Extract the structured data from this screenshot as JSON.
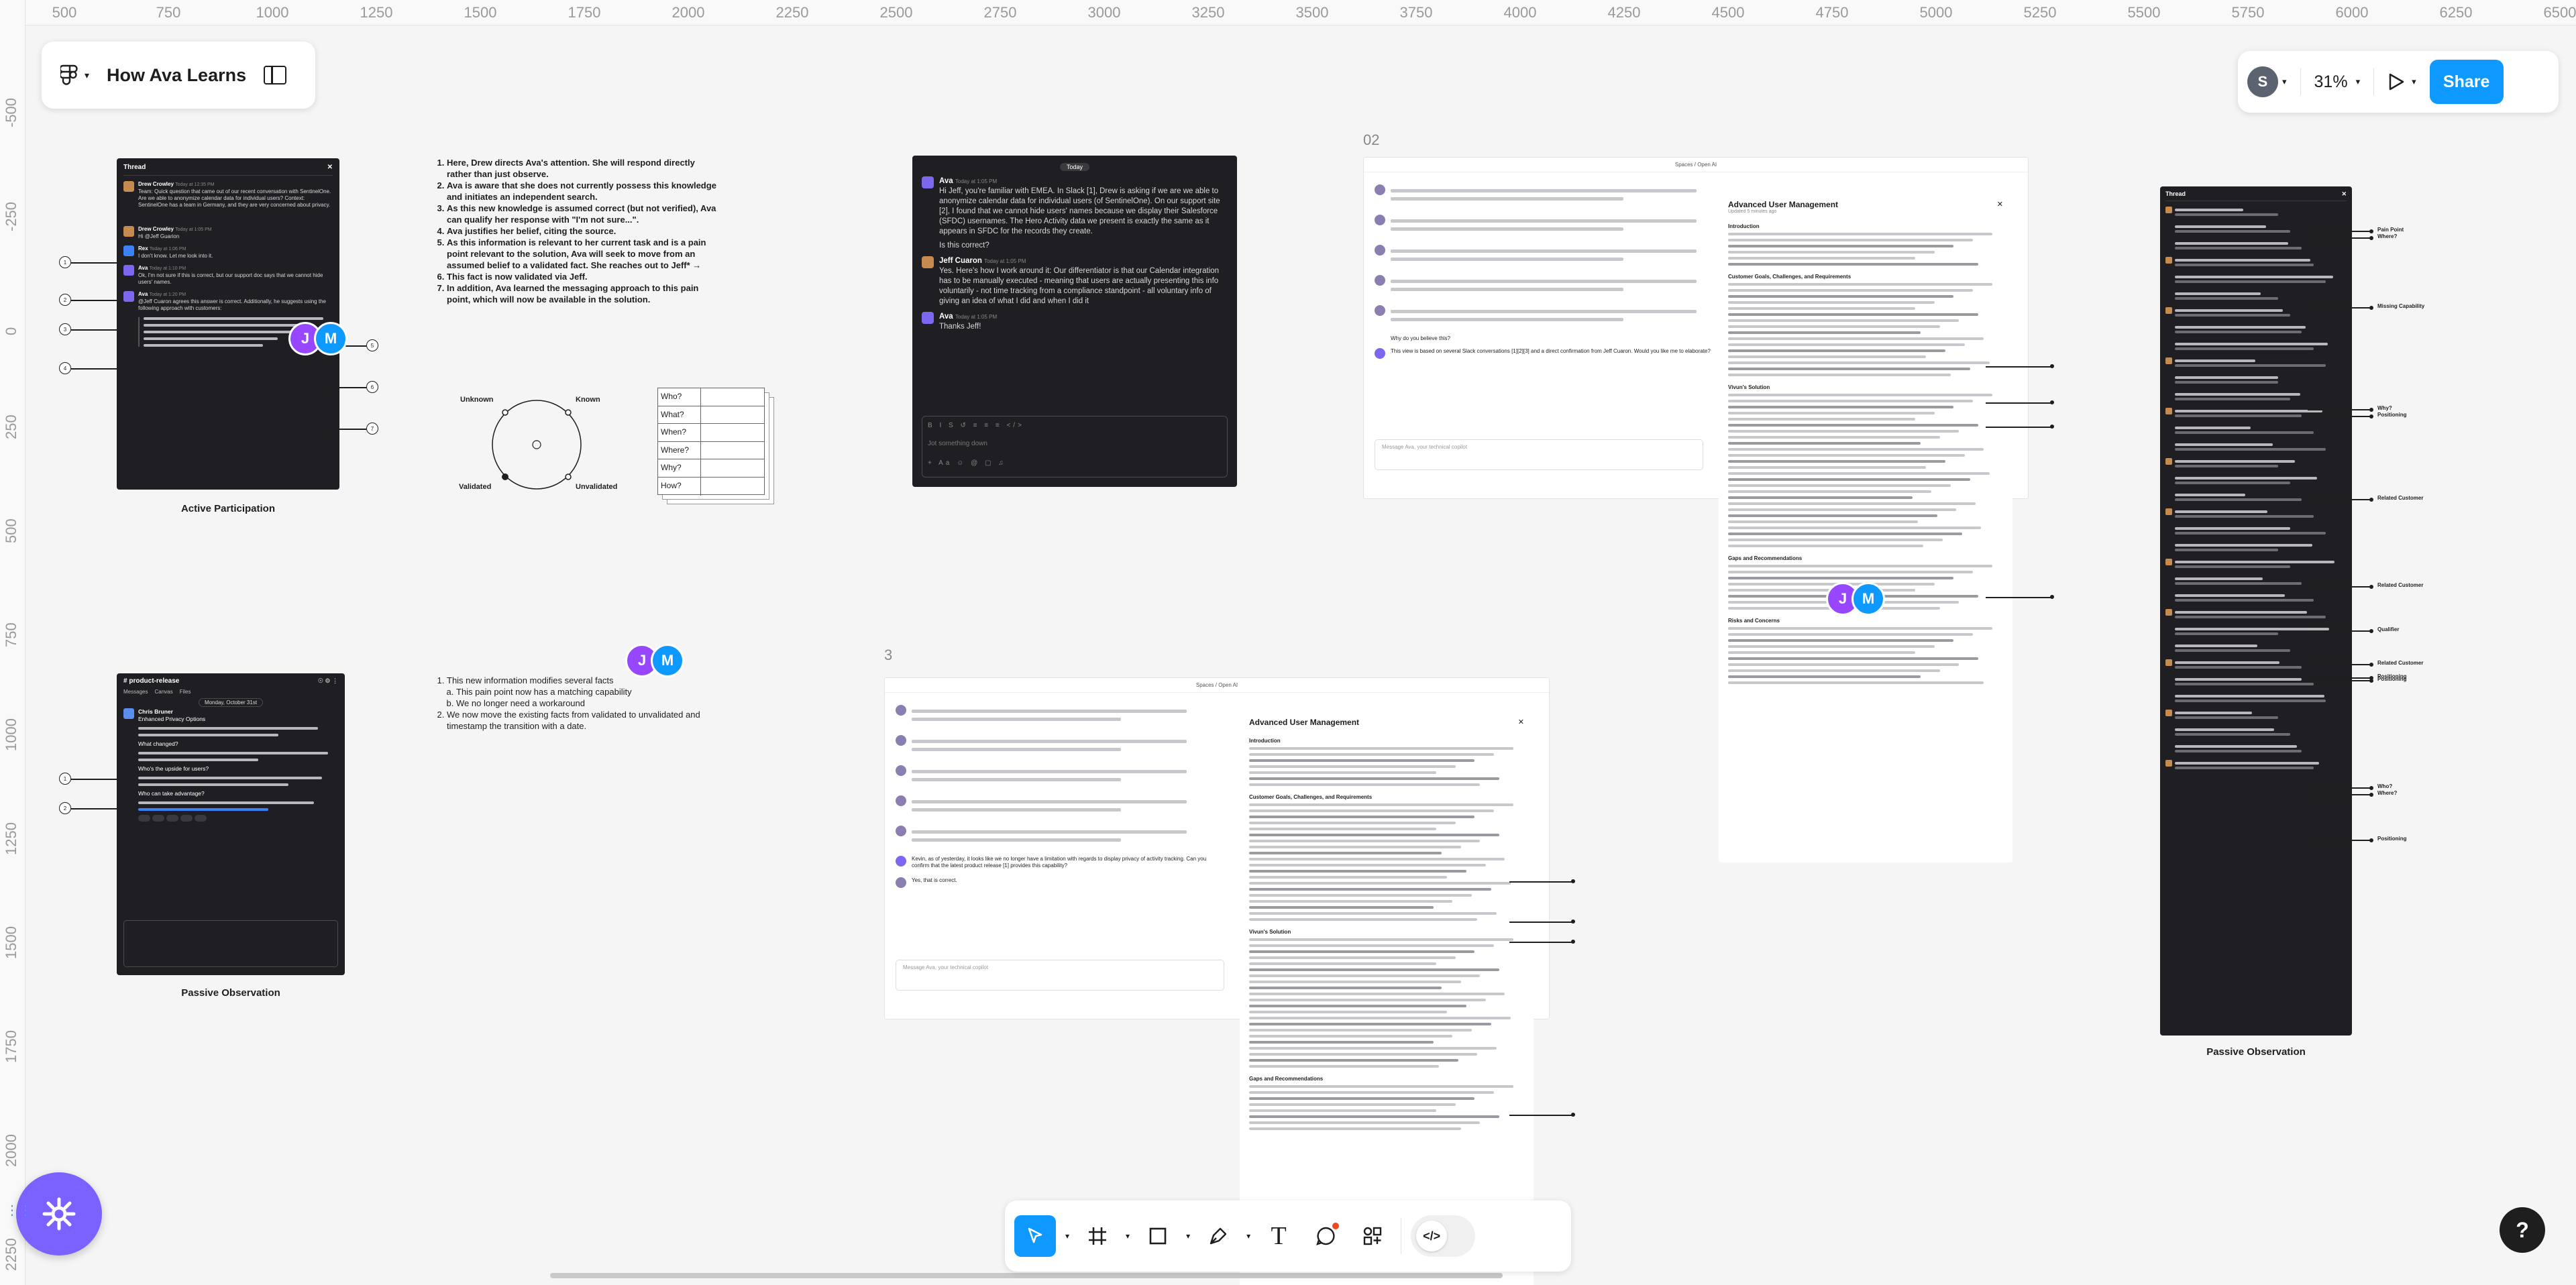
{
  "rulers": {
    "top": [
      "500",
      "750",
      "1000",
      "1250",
      "1500",
      "1750",
      "2000",
      "2250",
      "2500",
      "2750",
      "3000",
      "3250",
      "3500",
      "3750",
      "4000",
      "4250",
      "4500",
      "4750",
      "5000",
      "5250",
      "5500",
      "5750",
      "6000",
      "6250",
      "6500"
    ],
    "left": [
      "-500",
      "-250",
      "0",
      "250",
      "500",
      "750",
      "1000",
      "1250",
      "1500",
      "1750",
      "2000",
      "2250"
    ]
  },
  "header": {
    "title": "How Ava Learns"
  },
  "top_right": {
    "avatar_initial": "S",
    "zoom": "31%",
    "share_label": "Share"
  },
  "frames": {
    "frame2_label": "02",
    "frame3_label": "3"
  },
  "thread1": {
    "title": "Thread",
    "caption": "Active Participation",
    "messages": [
      {
        "name": "Drew Crowley",
        "time": "Today at 12:35 PM",
        "text": "Team: Quick question that came out of our recent conversation with SentinelOne. Are we able to anonymize calendar data for individual users? Context: SentinelOne has a team in Germany, and they are very concerned about privacy."
      },
      {
        "name": "Drew Crowley",
        "time": "Today at 1:05 PM",
        "text": "Hi @Jeff Guarion"
      },
      {
        "name": "Rex",
        "time": "Today at 1:06 PM",
        "text": "I don't know. Let me look into it."
      },
      {
        "name": "Ava",
        "time": "Today at 1:10 PM",
        "text": "Ok, I'm not sure if this is correct, but our support doc says that we cannot hide users' names."
      },
      {
        "name": "Ava",
        "time": "Today at 1:20 PM",
        "text": "@Jeff Cuaron agrees this answer is correct. Additionally, he suggests using the following approach with customers:"
      }
    ]
  },
  "notes1": {
    "items": [
      "Here, Drew directs Ava's attention. She will respond directly rather than just observe.",
      "Ava is aware that she does not currently possess this knowledge and initiates an independent search.",
      "As this new knowledge is assumed correct (but not verified), Ava can qualify her response with \"I'm not sure...\".",
      "Ava justifies her belief, citing the source.",
      "As this information is relevant to her current task and is a pain point relevant to the solution, Ava will seek to move from an assumed belief to a validated fact. She reaches out to Jeff* →",
      "This fact is now validated via Jeff.",
      "In addition, Ava learned the messaging approach to this pain point, which will now be available in the solution."
    ]
  },
  "diagram": {
    "unknown": "Unknown",
    "known": "Known",
    "validated": "Validated",
    "unvalidated": "Unvalidated"
  },
  "questions": [
    "Who?",
    "What?",
    "When?",
    "Where?",
    "Why?",
    "How?"
  ],
  "chat1": {
    "day": "Today",
    "msg1_name": "Ava",
    "msg1_time": "Today at 1:05 PM",
    "msg1_text": "Hi Jeff, you're familiar with EMEA. In Slack [1], Drew is asking if we are we able to anonymize calendar data for individual users (of SentinelOne). On our support site [2], I found that we cannot hide users' names because we display their Salesforce (SFDC) usernames. The Hero Activity data we present is exactly the same as it appears in SFDC for the records they create.",
    "msg1_q": "Is this correct?",
    "msg2_name": "Jeff Cuaron",
    "msg2_time": "Today at 1:05 PM",
    "msg2_text": "Yes. Here's how I work around it: Our differentiator is that our Calendar integration has to be manually executed - meaning that users are actually presenting this info voluntarily - not time tracking from a compliance standpoint - all voluntary info of giving an idea of what I did and when I did it",
    "msg3_name": "Ava",
    "msg3_time": "Today at 1:05 PM",
    "msg3_text": "Thanks Jeff!",
    "placeholder": "Jot something down"
  },
  "doc": {
    "breadcrumb": "Spaces / Open AI",
    "title": "Advanced User Management",
    "updated": "Updated 5 minutes ago",
    "intro_heading": "Introduction",
    "section1": "Customer Goals, Challenges, and Requirements",
    "section2": "Vivun's Solution",
    "section3": "Gaps and Recommendations",
    "section4": "Risks and Concerns",
    "chat_q": "Why do you believe this?",
    "chat_a": "This view is based on several Slack conversations [1][2][3] and a direct confirmation from Jeff Cuaron. Would you like me to elaborate?",
    "chat_placeholder": "Message Ava, your technical copilot"
  },
  "doc2": {
    "breadcrumb": "Spaces / Open AI",
    "title": "Advanced User Management",
    "kevin": "Kevin, as of yesterday, it looks like we no longer have a limitation with regards to display privacy of activity tracking. Can you confirm that the latest product release [1] provides this capability?",
    "yes": "Yes, that is correct.",
    "placeholder": "Message Ava, your technical copilot"
  },
  "channel": {
    "name": "# product-release",
    "caption": "Passive Observation",
    "tabs": [
      "Messages",
      "Canvas",
      "Files"
    ],
    "date": "Monday, October 31st",
    "author": "Chris Bruner",
    "text": "Enhanced Privacy Options",
    "q1": "What changed?",
    "q2": "Who's the upside for users?",
    "q3": "Who can take advantage?"
  },
  "notes2": {
    "items": [
      "This new information modifies several facts",
      "We no longer need a workaround",
      "We now move the existing facts from validated to unvalidated and timestamp the transition with a date."
    ],
    "sub": "This pain point now has a matching capability"
  },
  "thread2": {
    "title": "Thread",
    "caption": "Passive Observation",
    "annotations": [
      "Pain Point",
      "Where?",
      "Missing Capability",
      "Why?",
      "Positioning",
      "Related Customer",
      "Related Customer",
      "Qualifier",
      "Positioning",
      "Related Customer",
      "Positioning",
      "Who?",
      "Where?",
      "Positioning"
    ]
  },
  "presence": {
    "j": "J",
    "m": "M"
  },
  "bottom_toolbar": {
    "code_label": "</>"
  }
}
